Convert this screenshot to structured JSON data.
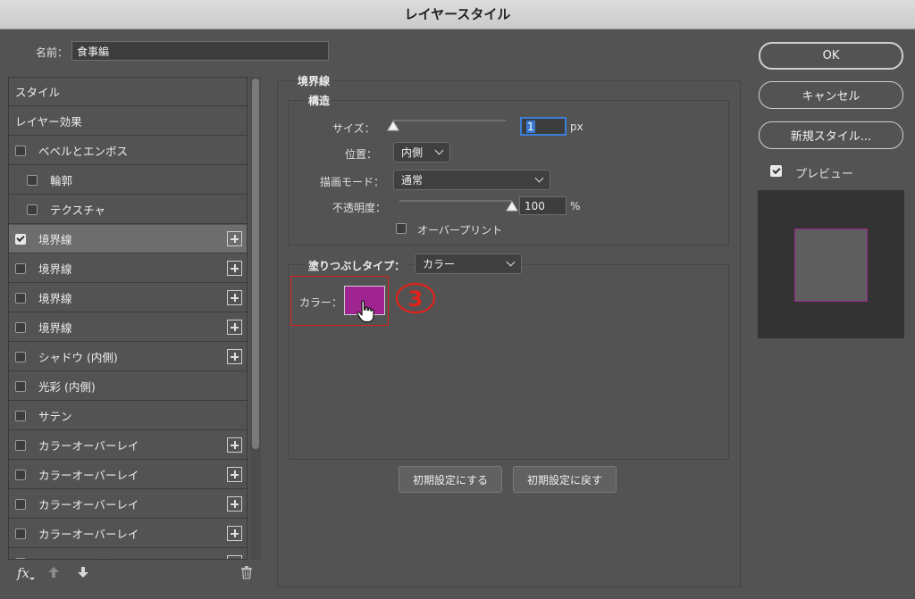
{
  "window": {
    "title": "レイヤースタイル"
  },
  "name_field": {
    "label": "名前：",
    "value": "食事編"
  },
  "style_list": {
    "items": [
      {
        "label": "スタイル",
        "checkbox": false,
        "checked": false,
        "plus": false,
        "indent": false,
        "selected": false
      },
      {
        "label": "レイヤー効果",
        "checkbox": false,
        "checked": false,
        "plus": false,
        "indent": false,
        "selected": false
      },
      {
        "label": "ベベルとエンボス",
        "checkbox": true,
        "checked": false,
        "plus": false,
        "indent": false,
        "selected": false
      },
      {
        "label": "輪郭",
        "checkbox": true,
        "checked": false,
        "plus": false,
        "indent": true,
        "selected": false
      },
      {
        "label": "テクスチャ",
        "checkbox": true,
        "checked": false,
        "plus": false,
        "indent": true,
        "selected": false
      },
      {
        "label": "境界線",
        "checkbox": true,
        "checked": true,
        "plus": true,
        "indent": false,
        "selected": true
      },
      {
        "label": "境界線",
        "checkbox": true,
        "checked": false,
        "plus": true,
        "indent": false,
        "selected": false
      },
      {
        "label": "境界線",
        "checkbox": true,
        "checked": false,
        "plus": true,
        "indent": false,
        "selected": false
      },
      {
        "label": "境界線",
        "checkbox": true,
        "checked": false,
        "plus": true,
        "indent": false,
        "selected": false
      },
      {
        "label": "シャドウ (内側)",
        "checkbox": true,
        "checked": false,
        "plus": true,
        "indent": false,
        "selected": false
      },
      {
        "label": "光彩 (内側)",
        "checkbox": true,
        "checked": false,
        "plus": false,
        "indent": false,
        "selected": false
      },
      {
        "label": "サテン",
        "checkbox": true,
        "checked": false,
        "plus": false,
        "indent": false,
        "selected": false
      },
      {
        "label": "カラーオーバーレイ",
        "checkbox": true,
        "checked": false,
        "plus": true,
        "indent": false,
        "selected": false
      },
      {
        "label": "カラーオーバーレイ",
        "checkbox": true,
        "checked": false,
        "plus": true,
        "indent": false,
        "selected": false
      },
      {
        "label": "カラーオーバーレイ",
        "checkbox": true,
        "checked": false,
        "plus": true,
        "indent": false,
        "selected": false
      },
      {
        "label": "カラーオーバーレイ",
        "checkbox": true,
        "checked": false,
        "plus": true,
        "indent": false,
        "selected": false
      },
      {
        "label": "カラーオーバーレイ",
        "checkbox": true,
        "checked": false,
        "plus": true,
        "indent": false,
        "selected": false
      }
    ]
  },
  "bottom_toolbar": {
    "fx_label": "fx"
  },
  "stroke": {
    "section_title": "境界線",
    "structure_title": "構造",
    "size_label": "サイズ：",
    "size_value": "1",
    "size_fraction": 0.0,
    "size_unit": "px",
    "position_label": "位置：",
    "position_value": "内側",
    "blend_label": "描画モード：",
    "blend_value": "通常",
    "opacity_label": "不透明度：",
    "opacity_value": "100",
    "opacity_fraction": 1.0,
    "opacity_unit": "%",
    "overprint_label": "オーバープリント",
    "overprint_checked": false,
    "fill_type_label": "塗りつぶしタイプ：",
    "fill_type_value": "カラー",
    "color_label": "カラー：",
    "color_value": "#a0248f",
    "annotation_number": "3",
    "annotation_color": "#e0231b",
    "default_set_label": "初期設定にする",
    "default_reset_label": "初期設定に戻す"
  },
  "actions": {
    "ok_label": "OK",
    "cancel_label": "キャンセル",
    "new_style_label": "新規スタイル...",
    "preview_label": "プレビュー",
    "preview_checked": true
  },
  "preview": {
    "swatch_fill": "#5e5e5e",
    "border_color": "#a0248f",
    "bg": "#333333"
  }
}
